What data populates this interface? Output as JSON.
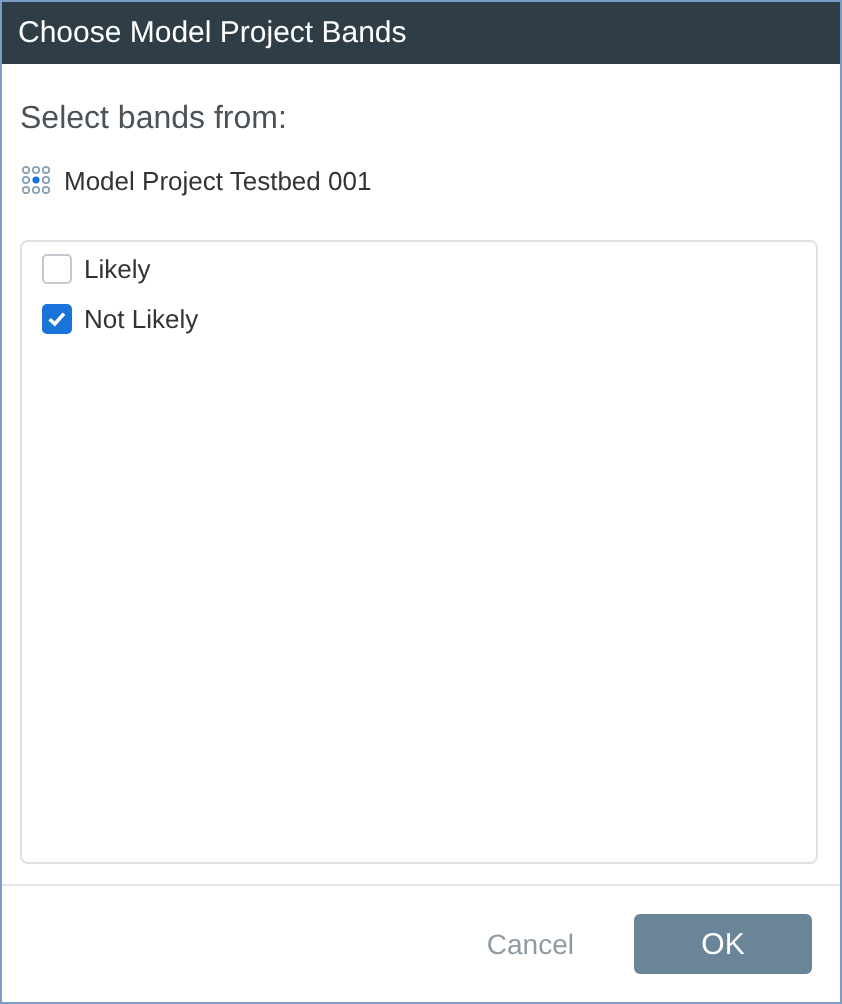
{
  "window": {
    "title": "Choose Model Project Bands"
  },
  "prompt": "Select bands from:",
  "source": {
    "name": "Model Project Testbed 001"
  },
  "bands": [
    {
      "label": "Likely",
      "checked": false
    },
    {
      "label": "Not Likely",
      "checked": true
    }
  ],
  "buttons": {
    "cancel": "Cancel",
    "ok": "OK"
  }
}
